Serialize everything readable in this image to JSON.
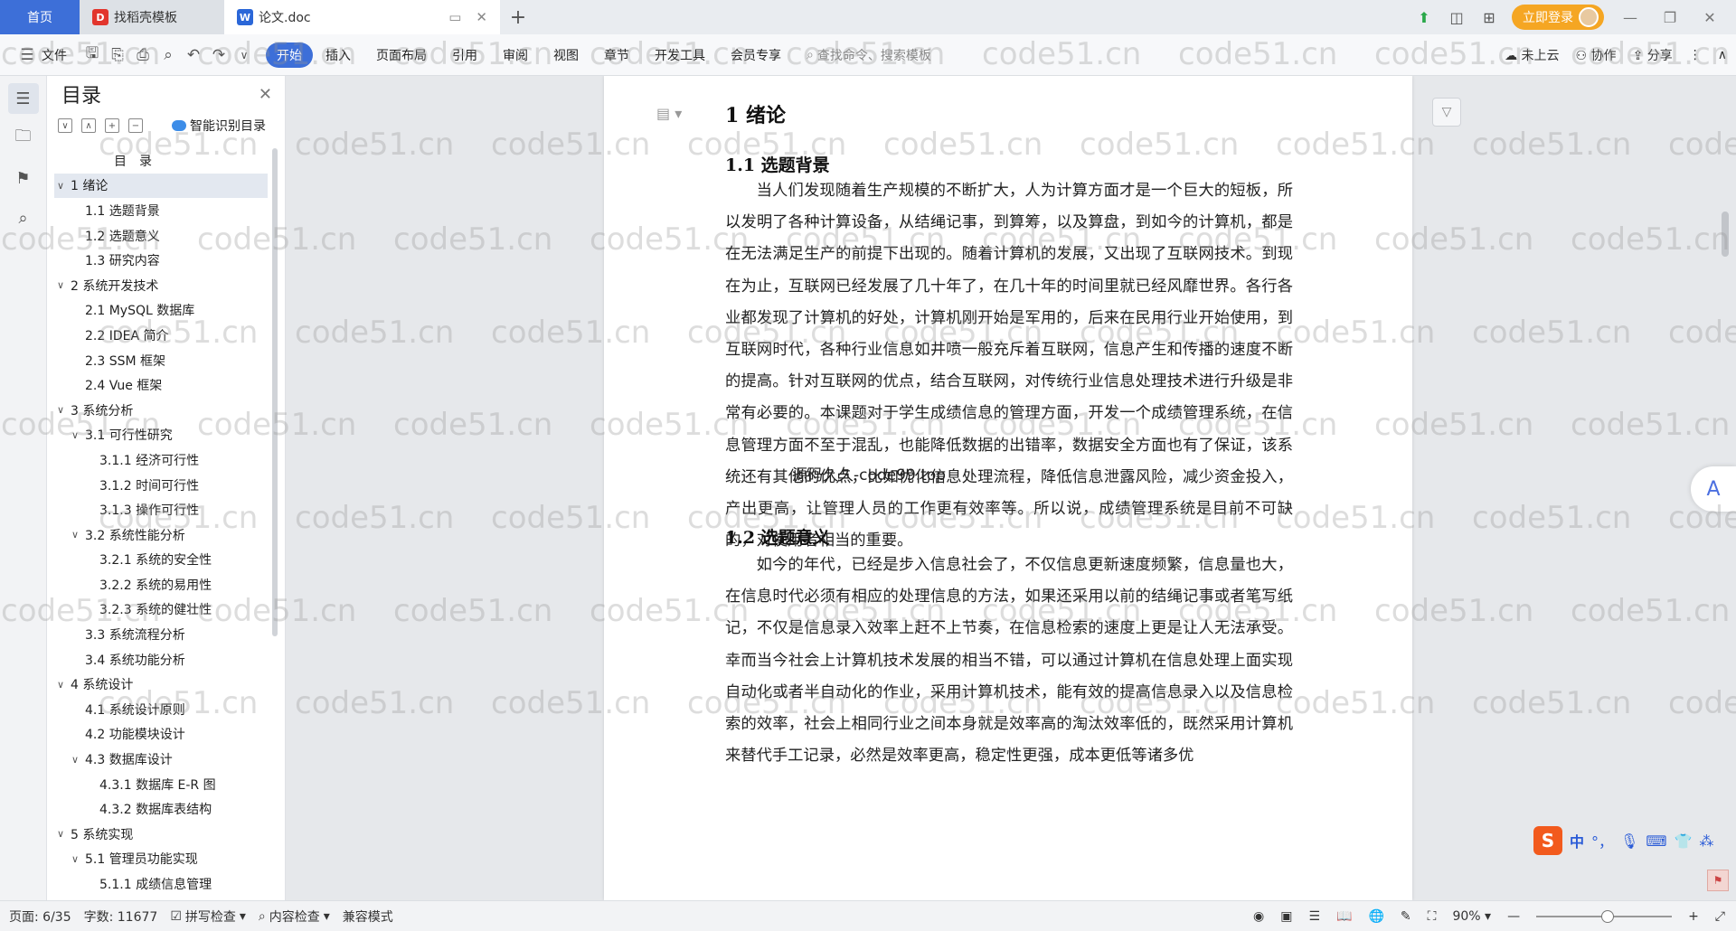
{
  "titlebar": {
    "tabs": [
      {
        "label": "首页"
      },
      {
        "label": "找稻壳模板"
      },
      {
        "label": "论文.doc"
      }
    ],
    "login_label": "立即登录"
  },
  "menubar": {
    "file_label": "文件",
    "items": [
      "开始",
      "插入",
      "页面布局",
      "引用",
      "审阅",
      "视图",
      "章节",
      "开发工具",
      "会员专享"
    ],
    "search_placeholder": "查找命令、搜索模板",
    "right": {
      "cloud": "未上云",
      "collab": "协作",
      "share": "分享"
    }
  },
  "toc": {
    "title": "目录",
    "smart_label": "智能识别目录",
    "items": [
      {
        "label": "目　录",
        "level": 0,
        "arrow": ""
      },
      {
        "label": "1  绪论",
        "level": 0,
        "arrow": "∨"
      },
      {
        "label": "1.1  选题背景",
        "level": 1,
        "arrow": ""
      },
      {
        "label": "1.2  选题意义",
        "level": 1,
        "arrow": ""
      },
      {
        "label": "1.3  研究内容",
        "level": 1,
        "arrow": ""
      },
      {
        "label": "2  系统开发技术",
        "level": 0,
        "arrow": "∨"
      },
      {
        "label": "2.1  MySQL 数据库",
        "level": 1,
        "arrow": ""
      },
      {
        "label": "2.2  IDEA 简介",
        "level": 1,
        "arrow": ""
      },
      {
        "label": "2.3  SSM 框架",
        "level": 1,
        "arrow": ""
      },
      {
        "label": "2.4  Vue 框架",
        "level": 1,
        "arrow": ""
      },
      {
        "label": "3  系统分析",
        "level": 0,
        "arrow": "∨"
      },
      {
        "label": "3.1  可行性研究",
        "level": 1,
        "arrow": "∨"
      },
      {
        "label": "3.1.1  经济可行性",
        "level": 2,
        "arrow": ""
      },
      {
        "label": "3.1.2  时间可行性",
        "level": 2,
        "arrow": ""
      },
      {
        "label": "3.1.3  操作可行性",
        "level": 2,
        "arrow": ""
      },
      {
        "label": "3.2  系统性能分析",
        "level": 1,
        "arrow": "∨"
      },
      {
        "label": "3.2.1  系统的安全性",
        "level": 2,
        "arrow": ""
      },
      {
        "label": "3.2.2  系统的易用性",
        "level": 2,
        "arrow": ""
      },
      {
        "label": "3.2.3  系统的健壮性",
        "level": 2,
        "arrow": ""
      },
      {
        "label": "3.3  系统流程分析",
        "level": 1,
        "arrow": ""
      },
      {
        "label": "3.4  系统功能分析",
        "level": 1,
        "arrow": ""
      },
      {
        "label": "4  系统设计",
        "level": 0,
        "arrow": "∨"
      },
      {
        "label": "4.1  系统设计原则",
        "level": 1,
        "arrow": ""
      },
      {
        "label": "4.2  功能模块设计",
        "level": 1,
        "arrow": ""
      },
      {
        "label": "4.3  数据库设计",
        "level": 1,
        "arrow": "∨"
      },
      {
        "label": "4.3.1  数据库 E-R 图",
        "level": 2,
        "arrow": ""
      },
      {
        "label": "4.3.2  数据库表结构",
        "level": 2,
        "arrow": ""
      },
      {
        "label": "5  系统实现",
        "level": 0,
        "arrow": "∨"
      },
      {
        "label": "5.1  管理员功能实现",
        "level": 1,
        "arrow": "∨"
      },
      {
        "label": "5.1.1  成绩信息管理",
        "level": 2,
        "arrow": ""
      }
    ]
  },
  "document": {
    "h1": "1  绪论",
    "h2_1": "1.1  选题背景",
    "para_1": "当人们发现随着生产规模的不断扩大，人为计算方面才是一个巨大的短板，所以发明了各种计算设备，从结绳记事，到算筹，以及算盘，到如今的计算机，都是在无法满足生产的前提下出现的。随着计算机的发展，又出现了互联网技术。到现在为止，互联网已经发展了几十年了，在几十年的时间里就已经风靡世界。各行各业都发现了计算机的好处，计算机刚开始是军用的，后来在民用行业开始使用，到互联网时代，各种行业信息如井喷一般充斥着互联网，信息产生和传播的速度不断的提高。针对互联网的优点，结合互联网，对传统行业信息处理技术进行升级是非常有必要的。本课题对于学生成绩信息的管理方面，开发一个成绩管理系统，在信息管理方面不至于混乱，也能降低数据的出错率，数据安全方面也有了保证，该系统还有其他的优点，比如优化信息处理流程，降低信息泄露风险，减少资金投入，产出更高，让管理人员的工作更有效率等。所以说，成绩管理系统是目前不可缺的，对使用者相当的重要。",
    "source_mark": "源码久久-code99.top",
    "h2_2": "1.2  选题意义",
    "para_2": "如今的年代，已经是步入信息社会了，不仅信息更新速度频繁，信息量也大，在信息时代必须有相应的处理信息的方法，如果还采用以前的结绳记事或者笔写纸记，不仅是信息录入效率上赶不上节奏，在信息检索的速度上更是让人无法承受。幸而当今社会上计算机技术发展的相当不错，可以通过计算机在信息处理上面实现自动化或者半自动化的作业，采用计算机技术，能有效的提高信息录入以及信息检索的效率，社会上相同行业之间本身就是效率高的淘汰效率低的，既然采用计算机来替代手工记录，必然是效率更高，稳定性更强，成本更低等诸多优"
  },
  "ime": {
    "lang": "中",
    "punct": "°，"
  },
  "watermark": "code51.cn",
  "status": {
    "page": "页面: 6/35",
    "words": "字数: 11677",
    "spell": "拼写检查",
    "content": "内容检查",
    "compat": "兼容模式",
    "zoom": "90%"
  },
  "colors": {
    "accent": "#3d6fd8",
    "login": "#f5a623"
  }
}
